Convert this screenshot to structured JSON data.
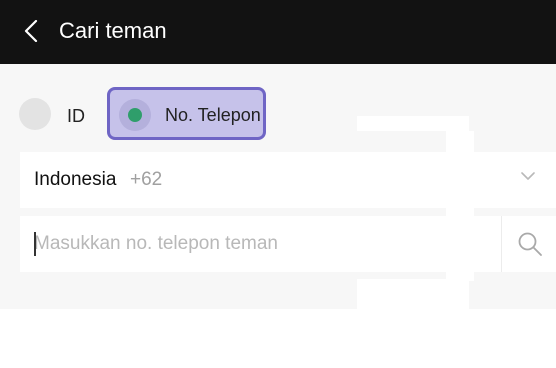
{
  "header": {
    "title": "Cari teman",
    "back_icon": "chevron-left-icon"
  },
  "search_mode": {
    "options": [
      {
        "label": "ID",
        "selected": false
      },
      {
        "label": "No. Telepon",
        "selected": true
      }
    ],
    "accent_color": "#6f65c5",
    "selected_dot_color": "#2f9e6b"
  },
  "country": {
    "name": "Indonesia",
    "code": "+62",
    "dropdown_icon": "chevron-down-icon"
  },
  "phone_search": {
    "value": "",
    "placeholder": "Masukkan no. telepon teman",
    "search_icon": "search-icon"
  }
}
